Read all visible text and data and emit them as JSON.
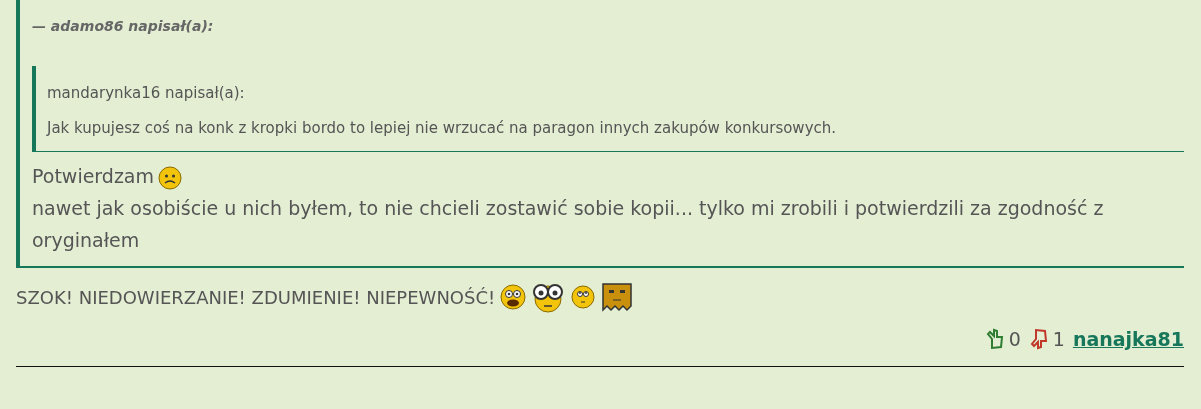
{
  "outer_quote": {
    "author_line": "— adamo86 napisał(a):",
    "inner_quote": {
      "author_line": "mandarynka16 napisał(a):",
      "text": "Jak kupujesz coś na konk z kropki bordo to lepiej nie wrzucać na paragon innych zakupów konkursowych."
    },
    "lines": [
      {
        "text": "Potwierdzam",
        "emoticons": [
          {
            "kind": "sad"
          }
        ]
      },
      {
        "text": "nawet jak osobiście u nich byłem, to nie chcieli zostawić sobie kopii... tylko mi zrobili i potwierdzili za zgodność z oryginałem"
      }
    ]
  },
  "post_text": {
    "text": "SZOK! NIEDOWIERZANIE! ZDUMIENIE! NIEPEWNOŚĆ!",
    "emoticons": [
      {
        "kind": "shocked"
      },
      {
        "kind": "big-eyes"
      },
      {
        "kind": "rolling-eyes"
      },
      {
        "kind": "paper-bag"
      }
    ]
  },
  "footer": {
    "likes": "0",
    "dislikes": "1",
    "author": "nanajka81"
  }
}
